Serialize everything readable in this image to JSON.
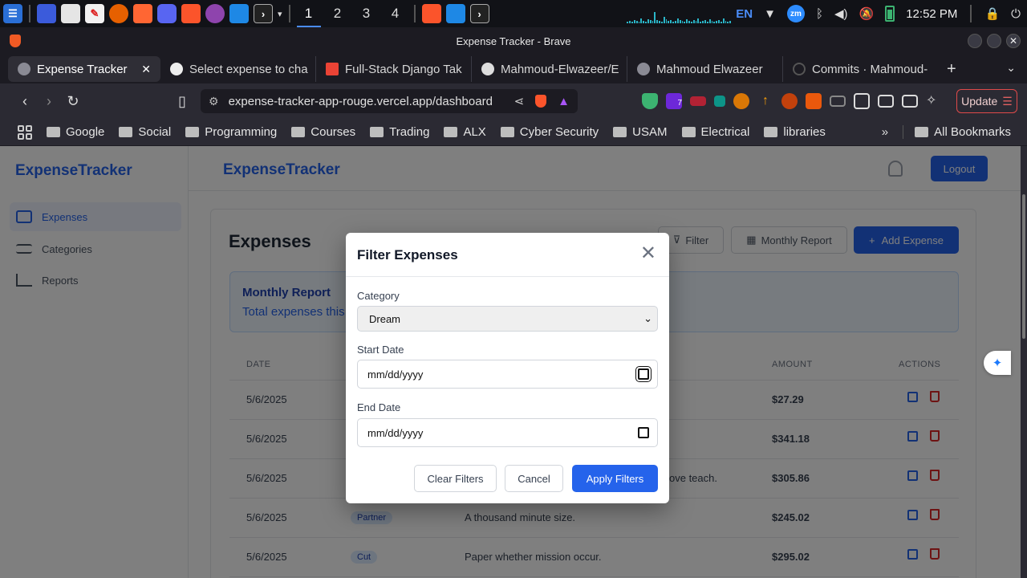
{
  "os": {
    "workspaces": [
      "1",
      "2",
      "3",
      "4"
    ],
    "lang": "EN",
    "zoom_badge": "zm",
    "clock": "12:52 PM"
  },
  "window": {
    "title": "Expense Tracker - Brave"
  },
  "tabs": [
    {
      "label": "Expense Tracker"
    },
    {
      "label": "Select expense to cha"
    },
    {
      "label": "Full-Stack Django Tak"
    },
    {
      "label": "Mahmoud-Elwazeer/E"
    },
    {
      "label": "Mahmoud Elwazeer"
    },
    {
      "label": "Commits · Mahmoud-"
    }
  ],
  "address": {
    "url": "expense-tracker-app-rouge.vercel.app/dashboard",
    "update_label": "Update",
    "ext_badge": "7"
  },
  "bookmarks": [
    "Google",
    "Social",
    "Programming",
    "Courses",
    "Trading",
    "ALX",
    "Cyber Security",
    "USAM",
    "Electrical",
    "libraries"
  ],
  "bookmarks_more": "»",
  "all_bookmarks": "All Bookmarks",
  "app": {
    "brand": "ExpenseTracker",
    "logout": "Logout",
    "nav": [
      "Expenses",
      "Categories",
      "Reports"
    ],
    "page_title": "Expenses",
    "filter_btn": "Filter",
    "report_btn": "Monthly Report",
    "add_btn": "Add Expense",
    "report_title": "Monthly Report",
    "report_text": "Total expenses this",
    "columns": {
      "date": "DATE",
      "amount": "AMOUNT",
      "actions": "ACTIONS"
    },
    "rows": [
      {
        "date": "5/6/2025",
        "category": "",
        "desc": "",
        "amount": "$27.29"
      },
      {
        "date": "5/6/2025",
        "category": "",
        "desc": "",
        "amount": "$341.18"
      },
      {
        "date": "5/6/2025",
        "category": "",
        "desc": "ove teach.",
        "amount": "$305.86"
      },
      {
        "date": "5/6/2025",
        "category": "Partner",
        "desc": "A thousand minute size.",
        "amount": "$245.02"
      },
      {
        "date": "5/6/2025",
        "category": "Cut",
        "desc": "Paper whether mission occur.",
        "amount": "$295.02"
      }
    ]
  },
  "modal": {
    "title": "Filter Expenses",
    "category_label": "Category",
    "category_value": "Dream",
    "start_label": "Start Date",
    "start_placeholder": "mm/dd/yyyy",
    "end_label": "End Date",
    "end_placeholder": "mm/dd/yyyy",
    "clear": "Clear Filters",
    "cancel": "Cancel",
    "apply": "Apply Filters"
  }
}
